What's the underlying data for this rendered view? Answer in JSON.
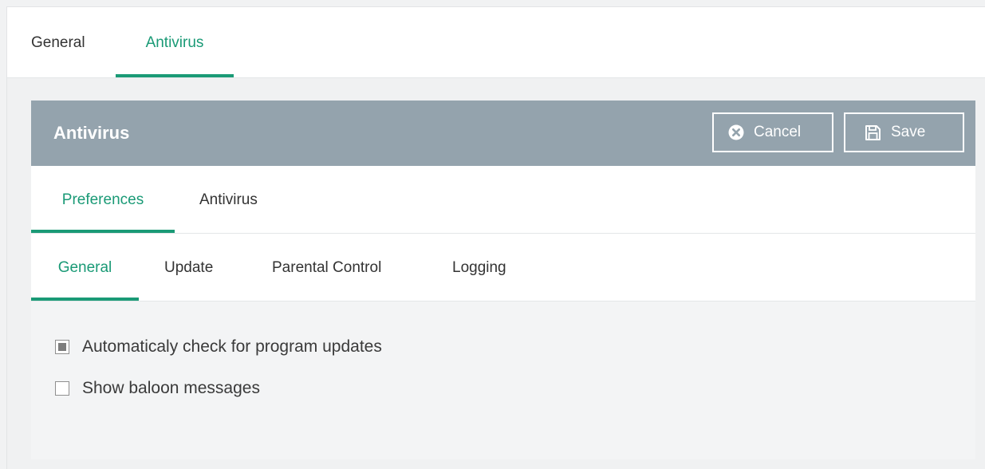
{
  "top_tabs": [
    {
      "label": "General",
      "active": false
    },
    {
      "label": "Antivirus",
      "active": true
    }
  ],
  "panel": {
    "title": "Antivirus",
    "cancel_label": "Cancel",
    "save_label": "Save",
    "cancel_icon": "x-circle-icon",
    "save_icon": "floppy-disk-icon"
  },
  "sub_tabs": [
    {
      "label": "Preferences",
      "active": true
    },
    {
      "label": "Antivirus",
      "active": false
    }
  ],
  "section_tabs": [
    {
      "label": "General",
      "active": true
    },
    {
      "label": "Update",
      "active": false
    },
    {
      "label": "Parental Control",
      "active": false
    },
    {
      "label": "Logging",
      "active": false
    }
  ],
  "options": [
    {
      "label": "Automaticaly check for program updates",
      "checked": true
    },
    {
      "label": "Show baloon messages",
      "checked": false
    }
  ],
  "colors": {
    "accent": "#1a9a76",
    "header_bg": "#94a3ad"
  }
}
